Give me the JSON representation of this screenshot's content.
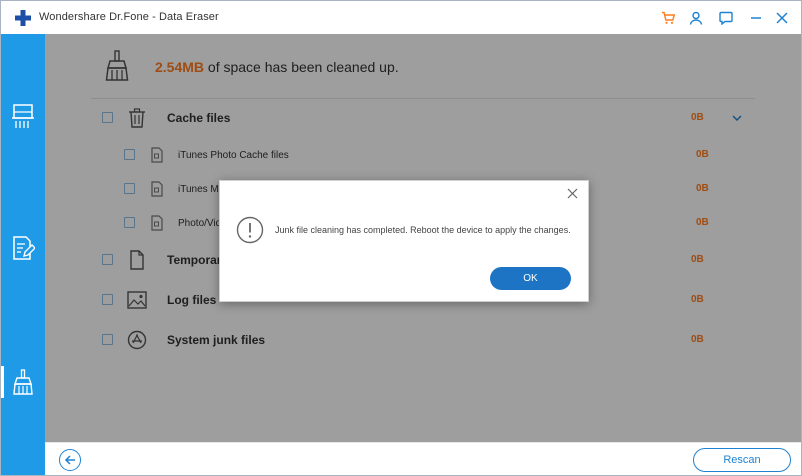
{
  "window": {
    "title": "Wondershare Dr.Fone - Data Eraser"
  },
  "titlebar": {
    "icons": [
      "cart-icon",
      "user-icon",
      "feedback-icon",
      "minimize-icon",
      "close-icon"
    ]
  },
  "colors": {
    "accent": "#1e9ae6",
    "orange": "#ff7c1f",
    "button": "#1e74c4",
    "overlay": "rgba(0,0,0,0.38)"
  },
  "sidebar": {
    "items": [
      {
        "icon": "erase-data-icon",
        "active": false
      },
      {
        "icon": "erase-private-icon",
        "active": false
      },
      {
        "icon": "cleanup-icon",
        "active": true
      }
    ]
  },
  "header": {
    "freed": "2.54MB",
    "text": " of space has been cleaned up."
  },
  "categories": [
    {
      "label": "Cache files",
      "size": "0B",
      "icon": "trash-icon",
      "level": 0
    },
    {
      "label": "iTunes Photo Cache files",
      "size": "0B",
      "icon": "file-icon",
      "level": 1
    },
    {
      "label": "iTunes Me",
      "size": "0B",
      "icon": "file-icon",
      "level": 1
    },
    {
      "label": "Photo/Vide",
      "size": "0B",
      "icon": "file-icon",
      "level": 1
    },
    {
      "label": "Temporar",
      "size": "0B",
      "icon": "document-icon",
      "level": 0
    },
    {
      "label": "Log files",
      "size": "0B",
      "icon": "image-icon",
      "level": 0
    },
    {
      "label": "System junk files",
      "size": "0B",
      "icon": "appstore-icon",
      "level": 0
    }
  ],
  "footer": {
    "rescan_label": "Rescan"
  },
  "dialog": {
    "message": "Junk file cleaning has completed. Reboot the device to apply the changes.",
    "ok_label": "OK"
  }
}
